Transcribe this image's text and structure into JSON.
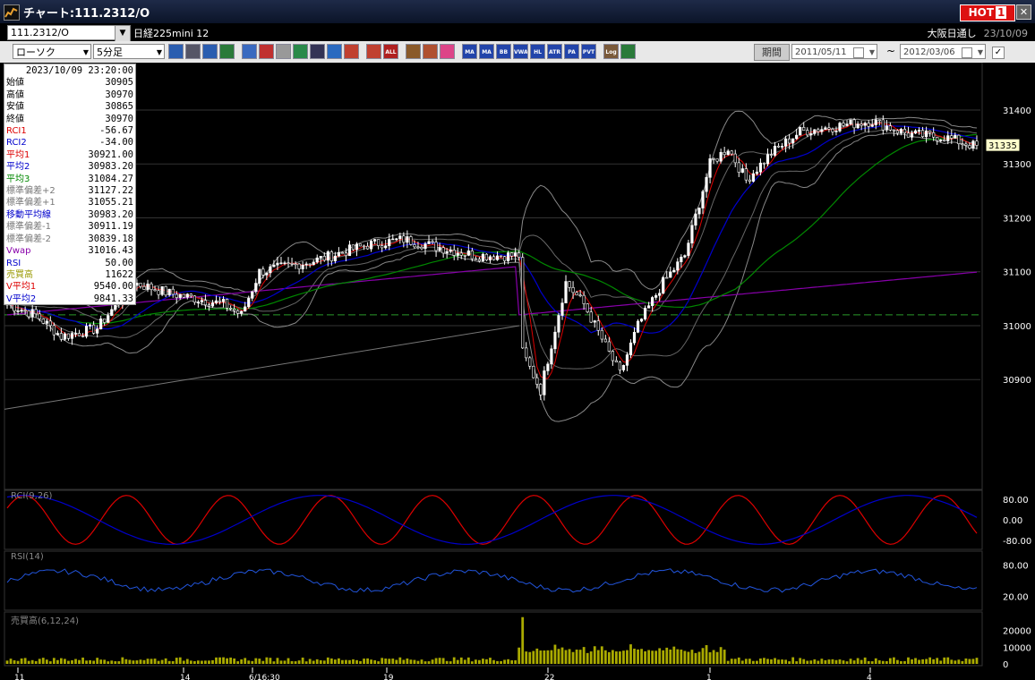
{
  "window": {
    "title": "チャート:111.2312/O",
    "hot_label": "HOT",
    "hot_number": "1",
    "close_label": "✕"
  },
  "symbol": {
    "code": "111.2312/O",
    "name": "日経225mini 12",
    "market": "大阪日通し",
    "date": "23/10/09"
  },
  "toolbar": {
    "chart_type": "ローソク",
    "interval": "5分足",
    "buttons": [
      "zoom",
      "grid",
      "wave",
      "view",
      "edit",
      "swap",
      "blank",
      "pen",
      "cursor",
      "back",
      "bar1",
      "bar2",
      "all",
      "gear",
      "brush",
      "palette",
      "ma",
      "ma2",
      "bb",
      "vwap",
      "hl",
      "atr",
      "pa",
      "pvt",
      "log",
      "export"
    ],
    "button_labels": {
      "ma": "MA",
      "ma2": "MA",
      "bb": "BB",
      "vwap": "VWAP",
      "hl": "HL",
      "atr": "ATR",
      "pa": "PA",
      "pvt": "PVT",
      "log": "Log",
      "all": "ALL"
    },
    "period_label": "期間",
    "date_from": "2011/05/11",
    "date_to": "2012/03/06",
    "tilde": "~",
    "check": "✓"
  },
  "info_panel": {
    "timestamp": "2023/10/09  23:20:00",
    "rows": [
      {
        "label": "始値",
        "value": "30905",
        "color": "#000000"
      },
      {
        "label": "高値",
        "value": "30970",
        "color": "#000000"
      },
      {
        "label": "安値",
        "value": "30865",
        "color": "#000000"
      },
      {
        "label": "終値",
        "value": "30970",
        "color": "#000000"
      },
      {
        "label": "RCI1",
        "value": "-56.67",
        "color": "#dd0000"
      },
      {
        "label": "RCI2",
        "value": "-34.00",
        "color": "#0000cc"
      },
      {
        "label": "平均1",
        "value": "30921.00",
        "color": "#dd0000"
      },
      {
        "label": "平均2",
        "value": "30983.20",
        "color": "#0000cc"
      },
      {
        "label": "平均3",
        "value": "31084.27",
        "color": "#008800"
      },
      {
        "label": "標準偏差+2",
        "value": "31127.22",
        "color": "#777777"
      },
      {
        "label": "標準偏差+1",
        "value": "31055.21",
        "color": "#777777"
      },
      {
        "label": "移動平均線",
        "value": "30983.20",
        "color": "#0000cc"
      },
      {
        "label": "標準偏差-1",
        "value": "30911.19",
        "color": "#777777"
      },
      {
        "label": "標準偏差-2",
        "value": "30839.18",
        "color": "#777777"
      },
      {
        "label": "Vwap",
        "value": "31016.43",
        "color": "#8800aa"
      },
      {
        "label": "RSI",
        "value": "50.00",
        "color": "#0000cc"
      },
      {
        "label": "売買高",
        "value": "11622",
        "color": "#999900"
      },
      {
        "label": "V平均1",
        "value": "9540.00",
        "color": "#dd0000"
      },
      {
        "label": "V平均2",
        "value": "9841.33",
        "color": "#0000cc"
      }
    ]
  },
  "price_axis": {
    "ticks": [
      "31400",
      "31300",
      "31200",
      "31100",
      "31000",
      "30900"
    ],
    "current_price": "31335"
  },
  "rci_panel": {
    "label": "RCI(9,26)",
    "ticks": [
      "80.00",
      "0.00",
      "-80.00"
    ]
  },
  "rsi_panel": {
    "label": "RSI(14)",
    "ticks": [
      "80.00",
      "20.00"
    ]
  },
  "volume_panel": {
    "label": "売買高(6,12,24)",
    "ticks": [
      "20000",
      "10000",
      "0"
    ]
  },
  "date_axis": {
    "labels": [
      "11",
      "14",
      "6/16:30",
      "19",
      "22",
      "1",
      "4"
    ]
  },
  "colors": {
    "up": "#ffffff",
    "down": "#000000",
    "ma1": "#dd0000",
    "ma2": "#0000cc",
    "ma3": "#008800",
    "bb": "#888888",
    "vwap": "#8800aa",
    "volume": "#aaaa00"
  }
}
